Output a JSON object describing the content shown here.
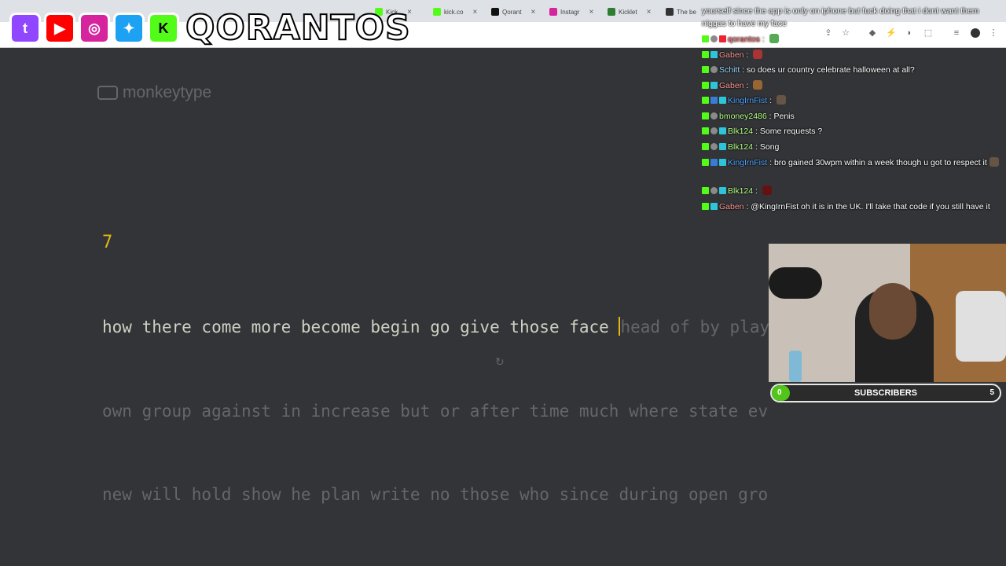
{
  "browser": {
    "tabs": [
      {
        "label": "Kick",
        "color": "#53fc18"
      },
      {
        "label": "kick.co",
        "color": "#53fc18"
      },
      {
        "label": "Qorant",
        "color": "#111111"
      },
      {
        "label": "Instagr",
        "color": "#d6249f"
      },
      {
        "label": "Kicklet",
        "color": "#2e7d32"
      },
      {
        "label": "The be",
        "color": "#333333"
      }
    ]
  },
  "overlay": {
    "brand": "QORANTOS",
    "socials": [
      {
        "name": "twitch-icon",
        "color": "#9146ff",
        "glyph": "t"
      },
      {
        "name": "youtube-icon",
        "color": "#ff0000",
        "glyph": "▶"
      },
      {
        "name": "instagram-icon",
        "color": "#d6249f",
        "glyph": "◎"
      },
      {
        "name": "twitter-icon",
        "color": "#1da1f2",
        "glyph": "✦"
      },
      {
        "name": "kick-icon",
        "color": "#53fc18",
        "glyph": "K"
      }
    ]
  },
  "monkeytype": {
    "logo": "monkeytype",
    "counter": "7",
    "typed_line1": "how there come more become begin go give those face ",
    "untyped_line1": "head of by play",
    "line2": "own group against in increase but or after time much where state even",
    "line3": "new will hold show he plan write no those who since during open group",
    "restart_glyph": "↻"
  },
  "chat": {
    "top_partial": "yourself since the app is only on iphone but fuck doing that i dont want them niggas to have my face",
    "messages": [
      {
        "user": "qorantos",
        "text": ""
      },
      {
        "user": "Gaben",
        "text": ""
      },
      {
        "user": "Schitt",
        "text": "so does ur country celebrate halloween at all?"
      },
      {
        "user": "Gaben",
        "text": ""
      },
      {
        "user": "KingIrnFist",
        "text": ""
      },
      {
        "user": "bmoney2486",
        "text": "Penis"
      },
      {
        "user": "Blk124",
        "text": "Some requests ?"
      },
      {
        "user": "Blk124",
        "text": "Song"
      },
      {
        "user": "KingIrnFist",
        "text": "bro gained 30wpm within a week though u got to respect it"
      },
      {
        "user": "Blk124",
        "text": ""
      },
      {
        "user": "Gaben",
        "text": "@KingIrnFist oh it is in the UK. I'll take that code if you still have it"
      }
    ]
  },
  "subscribers": {
    "label": "SUBSCRIBERS",
    "current": "0",
    "goal": "5",
    "progress": 0.08
  }
}
